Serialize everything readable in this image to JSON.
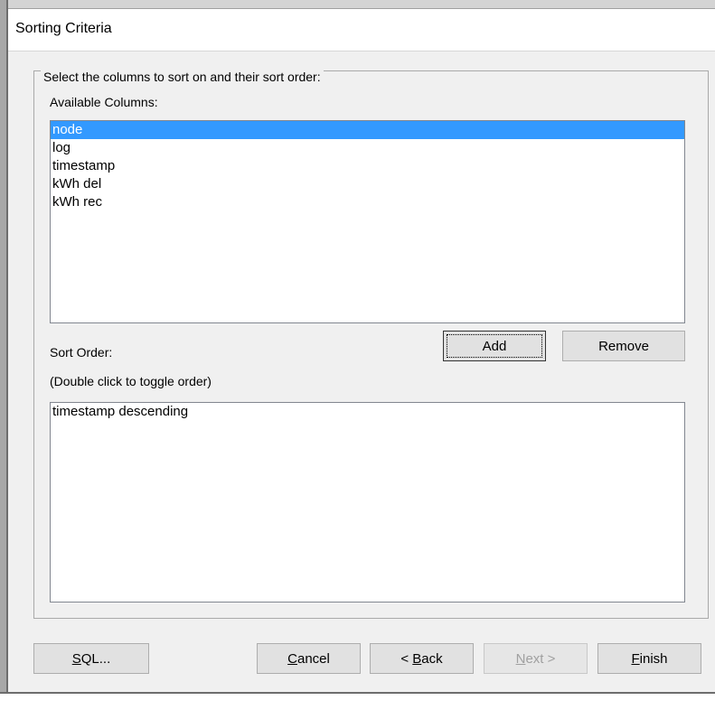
{
  "dialog": {
    "title": "Sorting Criteria"
  },
  "group": {
    "legend": "Select the columns to sort on and their sort order:",
    "available_label": "Available Columns:",
    "available_columns": [
      {
        "label": "node",
        "selected": true
      },
      {
        "label": "log",
        "selected": false
      },
      {
        "label": "timestamp",
        "selected": false
      },
      {
        "label": "kWh del",
        "selected": false
      },
      {
        "label": "kWh rec",
        "selected": false
      }
    ],
    "add_label": "Add",
    "remove_label": "Remove",
    "sort_order_label": "Sort Order:",
    "hint": "(Double click to toggle order)",
    "sort_order_items": [
      "timestamp descending"
    ]
  },
  "footer": {
    "sql": {
      "mnemonic": "S",
      "rest": "QL..."
    },
    "cancel": {
      "mnemonic": "C",
      "rest": "ancel"
    },
    "back": {
      "prefix": "< ",
      "mnemonic": "B",
      "rest": "ack"
    },
    "next": {
      "mnemonic": "N",
      "rest": "ext >",
      "disabled": true
    },
    "finish": {
      "mnemonic": "F",
      "rest": "inish"
    }
  },
  "colors": {
    "selection": "#3399ff",
    "dialog_bg": "#f0f0f0",
    "header_bg": "#ffffff"
  }
}
